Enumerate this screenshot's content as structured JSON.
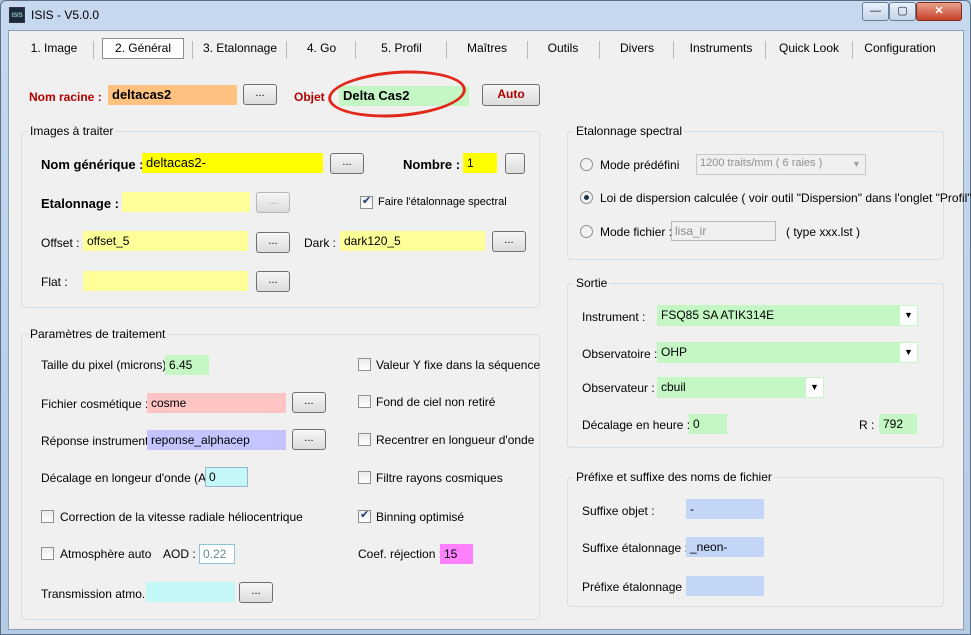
{
  "window": {
    "title": "ISIS - V5.0.0",
    "icon_text": "ISIS",
    "minimize_glyph": "—",
    "maximize_glyph": "▢",
    "close_glyph": "✕"
  },
  "tabs": [
    "1. Image",
    "2. Général",
    "3. Etalonnage",
    "4. Go",
    "5. Profil",
    "Maîtres",
    "Outils",
    "Divers",
    "Instruments",
    "Quick Look",
    "Configuration"
  ],
  "header": {
    "nom_racine_label": "Nom racine :",
    "nom_racine_value": "deltacas2",
    "objet_label": "Objet :",
    "objet_value": "Delta Cas2",
    "auto_label": "Auto",
    "browse_label": "..."
  },
  "images": {
    "title": "Images à traiter",
    "nom_generique_label": "Nom générique :",
    "nom_generique_value": "deltacas2-",
    "nombre_label": "Nombre :",
    "nombre_value": "1",
    "etalonnage_label": "Etalonnage :",
    "etalonnage_value": "",
    "faire_etalonnage_label": "Faire l'étalonnage spectral",
    "offset_label": "Offset :",
    "offset_value": "offset_5",
    "dark_label": "Dark :",
    "dark_value": "dark120_5",
    "flat_label": "Flat :",
    "flat_value": ""
  },
  "params": {
    "title": "Paramètres de traitement",
    "pixel_label": "Taille du pixel (microns) :",
    "pixel_value": "6.45",
    "cosmetique_label": "Fichier cosmétique :",
    "cosmetique_value": "cosme",
    "reponse_label": "Réponse instrument :",
    "reponse_value": "reponse_alphacep",
    "decalage_label": "Décalage en longeur d'onde (A) :",
    "decalage_value": "0",
    "correction_label": "Correction de la vitesse radiale héliocentrique",
    "atmosphere_label": "Atmosphère auto",
    "aod_label": "AOD :",
    "aod_value": "0.22",
    "transmission_label": "Transmission atmo. :",
    "transmission_value": "",
    "valeur_y_label": "Valeur Y fixe dans la séquence",
    "fond_ciel_label": "Fond de ciel non retiré",
    "recentrer_label": "Recentrer en longueur d'onde",
    "filtre_label": "Filtre rayons cosmiques",
    "binning_label": "Binning optimisé",
    "coef_label": "Coef. réjection :",
    "coef_value": "15"
  },
  "etalonnage_spectral": {
    "title": "Etalonnage spectral",
    "mode_predefini_label": "Mode prédéfini",
    "mode_predefini_value": "1200 traits/mm ( 6 raies )",
    "loi_label": "Loi de dispersion calculée ( voir outil \"Dispersion\" dans l'onglet \"Profil\" )",
    "mode_fichier_label": "Mode fichier :",
    "mode_fichier_value": "lisa_ir",
    "type_label": "( type xxx.lst )"
  },
  "sortie": {
    "title": "Sortie",
    "instrument_label": "Instrument :",
    "instrument_value": "FSQ85 SA ATIK314E",
    "observatoire_label": "Observatoire :",
    "observatoire_value": "OHP",
    "observateur_label": "Observateur :",
    "observateur_value": "cbuil",
    "decalage_heure_label": "Décalage en heure :",
    "decalage_heure_value": "0",
    "r_label": "R :",
    "r_value": "792"
  },
  "prefixe": {
    "title": "Préfixe et suffixe des noms de fichier",
    "suffixe_objet_label": "Suffixe objet :",
    "suffixe_objet_value": "-",
    "suffixe_etal_label": "Suffixe étalonnage :",
    "suffixe_etal_value": "_neon-",
    "prefixe_etal_label": "Préfixe étalonnage :",
    "prefixe_etal_value": ""
  },
  "colors": {
    "orange": "#ffc17f",
    "green": "#c4f7c4",
    "yellow": "#ffff00",
    "light_yellow": "#ffff99",
    "pink": "#ffc4c4",
    "lavender": "#c4c4ff",
    "cyan": "#c4f7f7",
    "magenta": "#ff80ff",
    "blue": "#c4d6f7",
    "highlight_ring": "#e0291b"
  },
  "dropdown_arrow": "▼"
}
